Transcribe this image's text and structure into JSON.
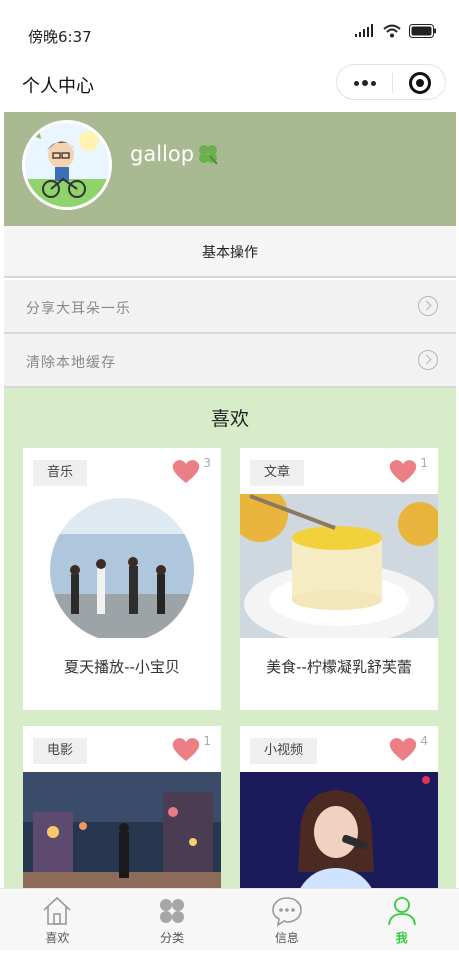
{
  "status_bar": {
    "time": "傍晚6:37"
  },
  "nav": {
    "title": "个人中心"
  },
  "profile": {
    "username": "gallop"
  },
  "basic_ops": {
    "title": "基本操作",
    "items": [
      {
        "label": "分享大耳朵一乐"
      },
      {
        "label": "清除本地缓存"
      }
    ]
  },
  "likes": {
    "title": "喜欢",
    "cards": [
      {
        "tag": "音乐",
        "likes": "3",
        "caption": "夏天播放--小宝贝"
      },
      {
        "tag": "文章",
        "likes": "1",
        "caption": "美食--柠檬凝乳舒芙蕾"
      },
      {
        "tag": "电影",
        "likes": "1",
        "caption": ""
      },
      {
        "tag": "小视频",
        "likes": "4",
        "caption": ""
      }
    ]
  },
  "tabbar": {
    "items": [
      {
        "label": "喜欢",
        "icon": "home-icon"
      },
      {
        "label": "分类",
        "icon": "category-icon"
      },
      {
        "label": "信息",
        "icon": "message-icon"
      },
      {
        "label": "我",
        "icon": "user-icon",
        "active": true
      }
    ]
  },
  "colors": {
    "accent": "#2fd03c",
    "profile_bg": "#a9b992",
    "likes_bg": "#d7edc9",
    "heart": "#ec7f86"
  }
}
